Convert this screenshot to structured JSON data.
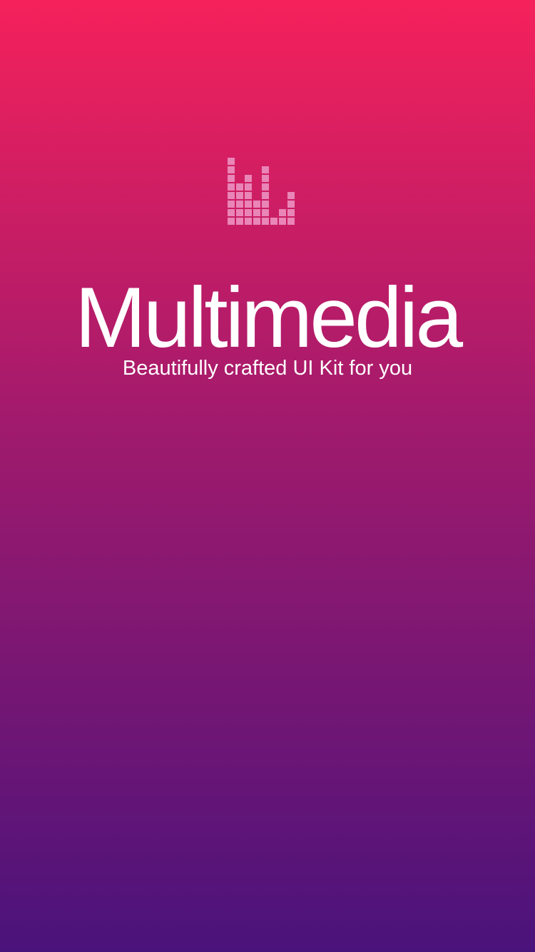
{
  "splash": {
    "logo_icon": "equalizer-bars-icon",
    "title": "Multimedia",
    "subtitle": "Beautifully crafted UI Kit for you"
  },
  "colors": {
    "gradient_top": "#f5215b",
    "gradient_mid": "#a01a6d",
    "gradient_bottom": "#4a137b",
    "logo_cell": "#e985b7",
    "text": "#ffffff"
  }
}
